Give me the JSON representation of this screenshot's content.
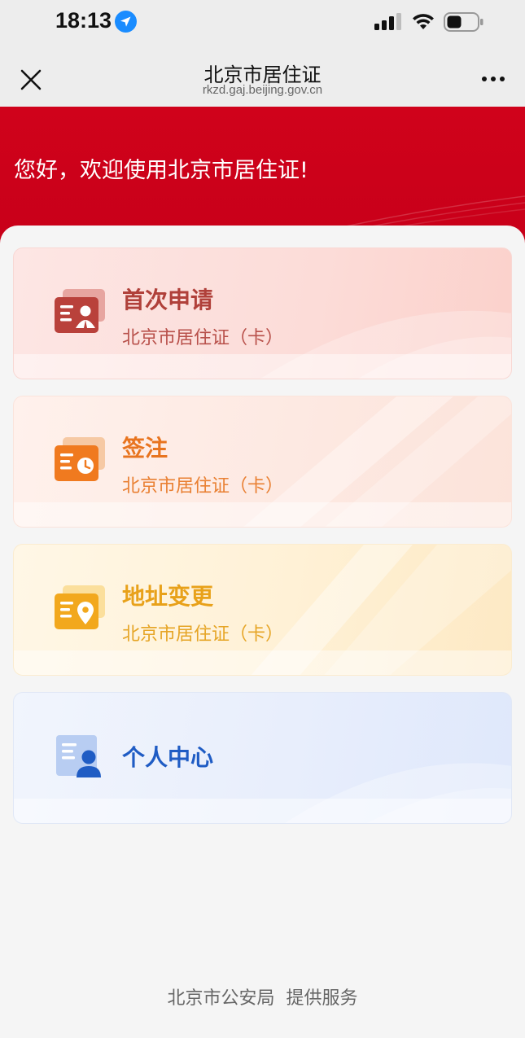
{
  "status_bar": {
    "time": "18:13",
    "icons": [
      "location-arrow-icon",
      "cellular-signal-icon",
      "wifi-icon",
      "battery-icon"
    ]
  },
  "nav": {
    "title": "北京市居住证",
    "url": "rkzd.gaj.beijing.gov.cn",
    "close_icon": "close-icon",
    "more_icon": "more-icon"
  },
  "banner": {
    "welcome": "您好，欢迎使用北京市居住证!",
    "color": "#d0021b"
  },
  "cards": [
    {
      "title": "首次申请",
      "subtitle": "北京市居住证（卡）",
      "icon": "id-card-person-icon",
      "accent": "#b0403a"
    },
    {
      "title": "签注",
      "subtitle": "北京市居住证（卡）",
      "icon": "id-card-clock-icon",
      "accent": "#e8741f"
    },
    {
      "title": "地址变更",
      "subtitle": "北京市居住证（卡）",
      "icon": "id-card-location-icon",
      "accent": "#e8a11a"
    },
    {
      "title": "个人中心",
      "icon": "user-profile-icon",
      "accent": "#1f5cc4"
    }
  ],
  "footer": {
    "provider": "北京市公安局",
    "service": "提供服务"
  }
}
